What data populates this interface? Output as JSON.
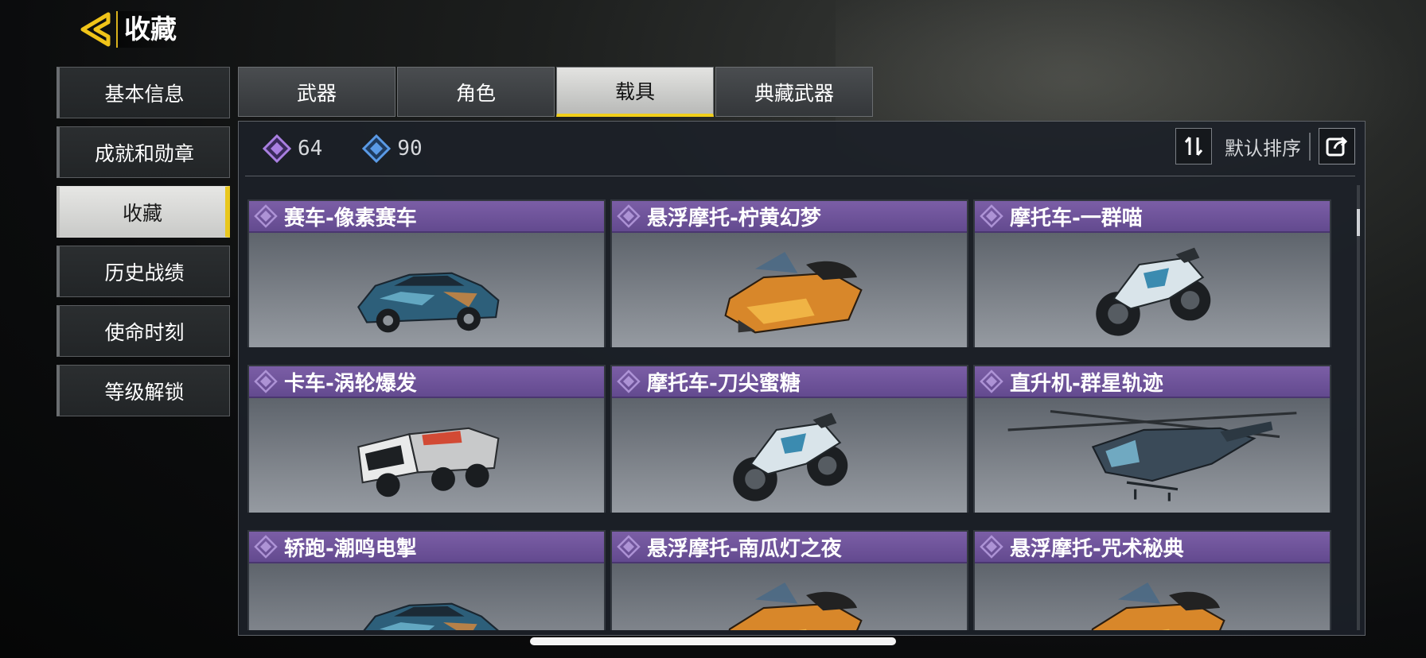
{
  "header": {
    "title": "收藏"
  },
  "sidebar": {
    "items": [
      {
        "label": "基本信息",
        "active": false
      },
      {
        "label": "成就和勋章",
        "active": false
      },
      {
        "label": "收藏",
        "active": true
      },
      {
        "label": "历史战绩",
        "active": false
      },
      {
        "label": "使命时刻",
        "active": false
      },
      {
        "label": "等级解锁",
        "active": false
      }
    ]
  },
  "tabs": [
    {
      "label": "武器",
      "active": false
    },
    {
      "label": "角色",
      "active": false
    },
    {
      "label": "载具",
      "active": true
    },
    {
      "label": "典藏武器",
      "active": false
    }
  ],
  "stats": [
    {
      "icon": "purple-diamond-icon",
      "value": "64",
      "color": "#a97fe0"
    },
    {
      "icon": "blue-diamond-icon",
      "value": "90",
      "color": "#5a9ae6"
    }
  ],
  "sort": {
    "label": "默认排序"
  },
  "items": [
    {
      "title": "赛车-像素赛车",
      "vehicle": "car"
    },
    {
      "title": "悬浮摩托-柠黄幻梦",
      "vehicle": "hoverbike"
    },
    {
      "title": "摩托车-一群喵",
      "vehicle": "motorcycle"
    },
    {
      "title": "卡车-涡轮爆发",
      "vehicle": "truck"
    },
    {
      "title": "摩托车-刀尖蜜糖",
      "vehicle": "motorcycle"
    },
    {
      "title": "直升机-群星轨迹",
      "vehicle": "helicopter"
    },
    {
      "title": "轿跑-潮鸣电掣",
      "vehicle": "car"
    },
    {
      "title": "悬浮摩托-南瓜灯之夜",
      "vehicle": "hoverbike"
    },
    {
      "title": "悬浮摩托-咒术秘典",
      "vehicle": "hoverbike"
    }
  ],
  "colors": {
    "accent": "#f1cf1b",
    "card_header": "#6f55a0"
  }
}
